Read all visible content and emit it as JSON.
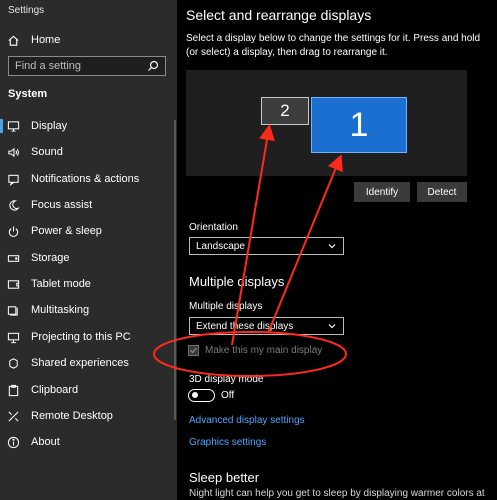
{
  "app": {
    "title": "Settings"
  },
  "sidebar": {
    "home_label": "Home",
    "search_placeholder": "Find a setting",
    "section_label": "System",
    "items": [
      {
        "label": "Display",
        "icon": "monitor-icon",
        "selected": true
      },
      {
        "label": "Sound",
        "icon": "speaker-icon"
      },
      {
        "label": "Notifications & actions",
        "icon": "notification-icon"
      },
      {
        "label": "Focus assist",
        "icon": "moon-icon"
      },
      {
        "label": "Power & sleep",
        "icon": "power-icon"
      },
      {
        "label": "Storage",
        "icon": "storage-icon"
      },
      {
        "label": "Tablet mode",
        "icon": "tablet-icon"
      },
      {
        "label": "Multitasking",
        "icon": "multitasking-icon"
      },
      {
        "label": "Projecting to this PC",
        "icon": "projecting-icon"
      },
      {
        "label": "Shared experiences",
        "icon": "shared-icon"
      },
      {
        "label": "Clipboard",
        "icon": "clipboard-icon"
      },
      {
        "label": "Remote Desktop",
        "icon": "remote-desktop-icon"
      },
      {
        "label": "About",
        "icon": "info-icon"
      }
    ]
  },
  "main": {
    "heading": "Select and rearrange displays",
    "description": "Select a display below to change the settings for it. Press and hold (or select) a display, then drag to rearrange it.",
    "monitors": [
      {
        "number": "2"
      },
      {
        "number": "1"
      }
    ],
    "identify_label": "Identify",
    "detect_label": "Detect",
    "orientation_label": "Orientation",
    "orientation_value": "Landscape",
    "multiple_heading": "Multiple displays",
    "multiple_label": "Multiple displays",
    "multiple_value": "Extend these displays",
    "main_display_label": "Make this my main display",
    "main_display_checked": true,
    "main_display_enabled": false,
    "three_d_label": "3D display mode",
    "three_d_state": "Off",
    "advanced_link": "Advanced display settings",
    "graphics_link": "Graphics settings",
    "sleep_heading": "Sleep better",
    "sleep_text": "Night light can help you get to sleep by displaying warmer colors at"
  },
  "colors": {
    "accent": "#4aa6ff",
    "selected_monitor": "#1a6fd1",
    "annotation": "#ff2a1a"
  }
}
